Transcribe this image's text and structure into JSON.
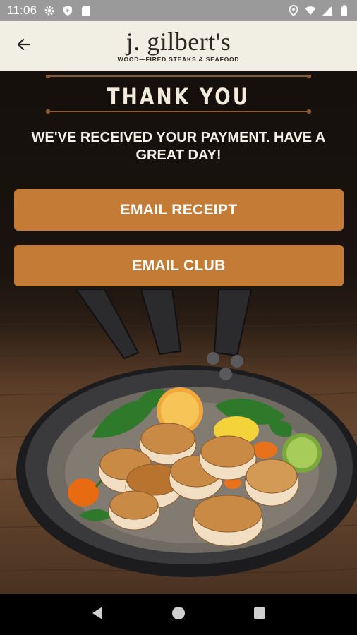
{
  "status_bar": {
    "time": "11:06",
    "left_icons": [
      "gear-icon",
      "shield-icon",
      "sd-card-icon"
    ],
    "right_icons": [
      "location-icon",
      "wifi-icon",
      "signal-icon",
      "battery-icon"
    ]
  },
  "header": {
    "back_icon": "arrow-left-icon",
    "logo_name": "j. gilbert's",
    "logo_tagline": "WOOD—FIRED STEAKS & SEAFOOD",
    "background": "#f1efe3"
  },
  "main": {
    "title": "THANK YOU",
    "message": "WE'VE RECEIVED YOUR PAYMENT. HAVE A GREAT DAY!",
    "buttons": {
      "email_receipt": "EMAIL RECEIPT",
      "email_club": "EMAIL CLUB"
    },
    "button_color": "#c47b36"
  },
  "nav_bar": {
    "icons": [
      "back-triangle-icon",
      "home-circle-icon",
      "recents-square-icon"
    ]
  }
}
